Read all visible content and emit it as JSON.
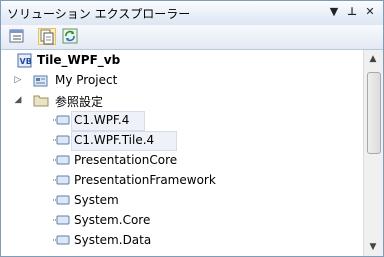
{
  "window": {
    "title": "ソリューション エクスプローラー",
    "buttons": {
      "dropdown": "▼",
      "pin": "⊥",
      "close": "✕"
    }
  },
  "toolbar": {
    "tools": [
      {
        "icon": "properties-icon"
      },
      {
        "icon": "show-all-files-icon",
        "selected": true
      },
      {
        "icon": "refresh-icon"
      }
    ]
  },
  "tree": {
    "project": "Tile_WPF_vb",
    "my_project": "My Project",
    "references": "参照設定",
    "items": [
      "C1.WPF.4",
      "C1.WPF.Tile.4",
      "PresentationCore",
      "PresentationFramework",
      "System",
      "System.Core",
      "System.Data"
    ]
  },
  "scrollbar": {
    "up": "▲",
    "down": "▼"
  }
}
